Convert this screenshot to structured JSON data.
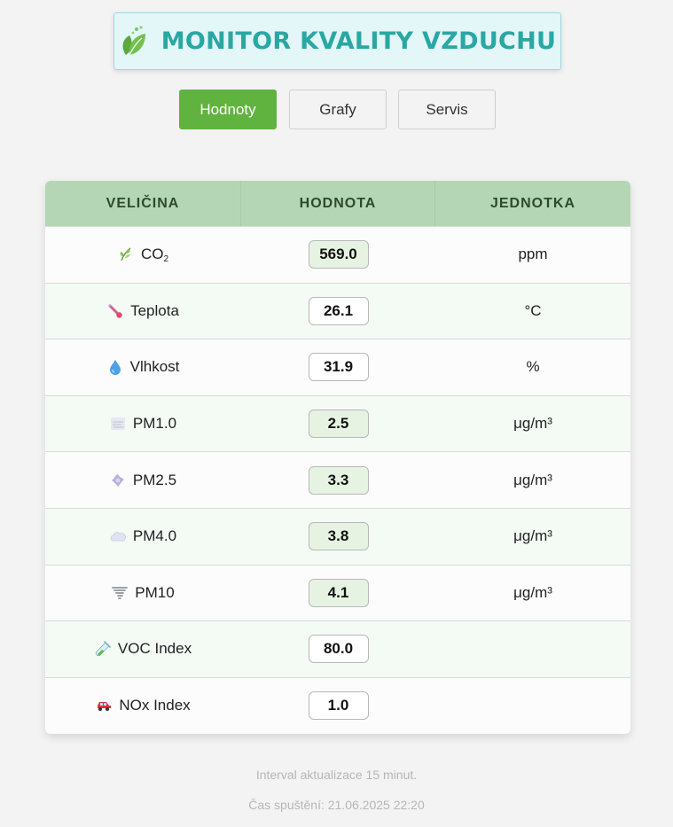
{
  "header": {
    "title": "MONITOR KVALITY VZDUCHU",
    "icon": "leaf-icon",
    "accent_color": "#2aa7a3"
  },
  "tabs": [
    {
      "label": "Hodnoty",
      "active": true
    },
    {
      "label": "Grafy",
      "active": false
    },
    {
      "label": "Servis",
      "active": false
    }
  ],
  "table": {
    "columns": [
      "VELIČINA",
      "HODNOTA",
      "JEDNOTKA"
    ],
    "rows": [
      {
        "icon": "plant-icon",
        "name": "CO",
        "name_sub": "2",
        "value": "569.0",
        "unit": "ppm",
        "tinted": true
      },
      {
        "icon": "thermometer-icon",
        "name": "Teplota",
        "value": "26.1",
        "unit": "°C",
        "tinted": false
      },
      {
        "icon": "droplet-icon",
        "name": "Vlhkost",
        "value": "31.9",
        "unit": "%",
        "tinted": false
      },
      {
        "icon": "fog-icon",
        "name": "PM1.0",
        "value": "2.5",
        "unit": "μg/m³",
        "tinted": true
      },
      {
        "icon": "dust-icon",
        "name": "PM2.5",
        "value": "3.3",
        "unit": "μg/m³",
        "tinted": true
      },
      {
        "icon": "cloud-icon",
        "name": "PM4.0",
        "value": "3.8",
        "unit": "μg/m³",
        "tinted": true
      },
      {
        "icon": "tornado-icon",
        "name": "PM10",
        "value": "4.1",
        "unit": "μg/m³",
        "tinted": true
      },
      {
        "icon": "test-tube-icon",
        "name": "VOC Index",
        "value": "80.0",
        "unit": "",
        "tinted": false
      },
      {
        "icon": "car-icon",
        "name": "NOx Index",
        "value": "1.0",
        "unit": "",
        "tinted": false
      }
    ]
  },
  "footer": {
    "interval_text": "Interval aktualizace 15 minut.",
    "start_text": "Čas spuštění: 21.06.2025 22:20"
  }
}
